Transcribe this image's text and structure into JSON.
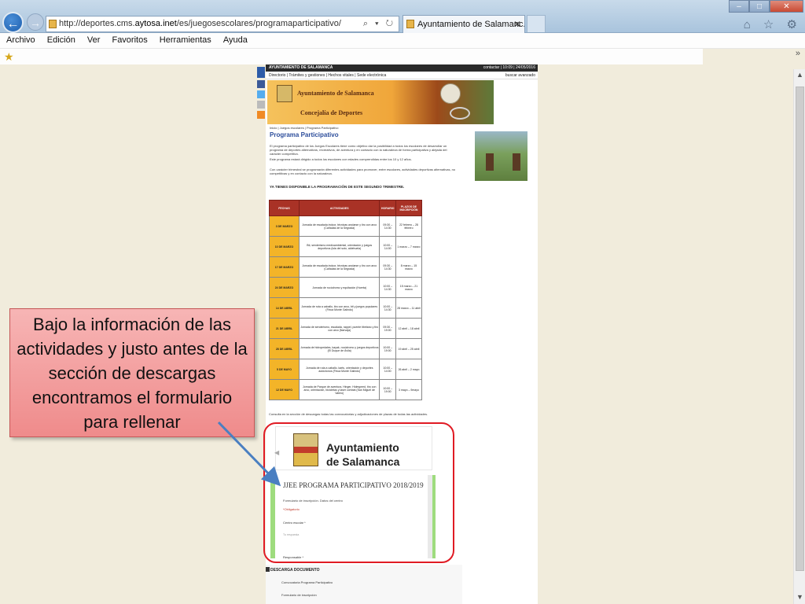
{
  "browser": {
    "url_prefix": "http://deportes.cms.",
    "url_domain": "aytosa.inet",
    "url_path": "/es/juegosescolares/programaparticipativo/",
    "address_tools": "⌕ ▾ ↻",
    "tab_title": "Ayuntamiento de Salamanc...",
    "tab_close": "✕",
    "back_glyph": "←",
    "forward_glyph": "→",
    "home_icon": "home-icon",
    "chrome_icons": "⌂ ☆ ⚙",
    "window_controls": {
      "minimize": "–",
      "maximize": "□",
      "close": "✕"
    },
    "menu": [
      "Archivo",
      "Edición",
      "Ver",
      "Favoritos",
      "Herramientas",
      "Ayuda"
    ],
    "favbar_expand": "»",
    "fav_star": "★"
  },
  "site": {
    "top_bar_left": "AYUNTAMIENTO DE SALAMANCA",
    "top_bar_right": "contactar | 10:09 | 24/05/2016",
    "nav": "Directorio | Trámites y gestiones | Hechos vitales | Sede electrónica",
    "nav_right": "buscar  avanzado",
    "banner_title": "Ayuntamiento de Salamanca",
    "banner_subtitle": "Concejalía de Deportes",
    "breadcrumb": "Inicio  |  Juegos escolares  |  Programa Participativo",
    "page_title": "Programa Participativo",
    "para1": "El programa participativo de los Juegos Escolares tiene como objetivo dar la posibilidad a todos los escolares de desarrollar un programa de deportes alternativos, recreativos, de aventura y en contacto con la naturaleza de forma participativa y alejada del carácter competitivo.",
    "para2": "Este programa estará dirigido a todos los escolares con edades comprendidas entre los 10 y 12 años.",
    "para3": "Con carácter trimestral se programarán diferentes actividades para promover, entre escolares, actividades deportivas alternativas, no competitivas y en contacto con la naturaleza.",
    "stage_note": "YA TIENES DISPONIBLE LA PROGRAMACIÓN DE ESTE SEGUNDO TRIMESTRE.",
    "table": {
      "headers": [
        "FECHAS",
        "ACTIVIDADES",
        "HORARIO",
        "PLAZOS DE INSCRIPCIÓN"
      ],
      "rows": [
        [
          "3 DE MARZO",
          "Jornada de escalada indoor, técnicas anclarse y tiro con arco (Cañadas de la Segrada)",
          "09:30 – 14:30",
          "22 febrero – 28 febrero"
        ],
        [
          "10 DE MARZO",
          "Bti, senderismo medioambiental, orientación y juegos deportivos (isla del soto, aldehuela)",
          "10:00 – 14:00",
          "1 marzo – 7 marzo"
        ],
        [
          "17 DE MARZO",
          "Jornada de escalada indoor, técnicas anclarse y tiro con arco (Cañadas de la Segrada)",
          "09:30 – 14:30",
          "8 marzo – 15 marzo"
        ],
        [
          "24 DE MARZO",
          "Jornada de rocódromo y equitación (Huerta)",
          "10:00 – 14:30",
          "15 marzo – 21 marzo"
        ],
        [
          "14 DE ABRIL",
          "Jornada de ruta a caballo, tiro con arco, bti y juegos populares (Finca Monte Galindo)",
          "10:00 – 14:30",
          "28 marzo – 11 abril"
        ],
        [
          "21 DE ABRIL",
          "Jornada de senderismo, escalada, rappel, puente tibetano y tiro con arco (Narvaja)",
          "09:30 – 19:00",
          "12 abril – 18 abril"
        ],
        [
          "28 DE ABRIL",
          "Jornada de hidropedales, kayak, rocódromo y juegos deportivos (El Duque de Ávila)",
          "10:00 – 19:00",
          "19 abril – 25 abril"
        ],
        [
          "5 DE MAYO",
          "Jornada de ruta a caballo, karts, orientación y deportes autóctonos (Finca Monte Galindo)",
          "10:00 – 14:00",
          "26 abril – 2 mayo"
        ],
        [
          "12 DE MAYO",
          "Jornada de Parque de aventura, Hinger, Hidespeed, tiro con arco, orientación, bicicletas y laser combat (San Miguel de Valero)",
          "10:00 – 19:00",
          "3 mayo – 9mayo"
        ]
      ]
    },
    "consulta": "Consulta en la sección de descargas todas las convocatorias y adjudicaciones de plazas de todas las actividades.",
    "downloads": {
      "title": "DESCARGA DOCUMENTO",
      "item1": "Convocatoria Programa Participativo",
      "item2": "Formulario de inscripción"
    }
  },
  "form": {
    "org_line1": "Ayuntamiento",
    "org_line2": "de Salamanca",
    "title": "JJEE PROGRAMA PARTICIPATIVO 2018/2019",
    "subtitle": "Formulario de inscripción. Datos del centro",
    "required": "*Obligatorio",
    "field_centro": "Centro escolar *",
    "placeholder": "Tu respuesta",
    "field_responsable": "Responsable *"
  },
  "callout": {
    "text": "Bajo la información de las actividades y justo antes de la sección de descargas encontramos el formulario para rellenar"
  },
  "colors": {
    "highlight": "#e01b24",
    "callout_fill": "#f19b9b",
    "table_header": "#a93226",
    "table_date": "#f3b428",
    "form_accent": "#9edc7e",
    "title_blue": "#2c4d9b"
  }
}
